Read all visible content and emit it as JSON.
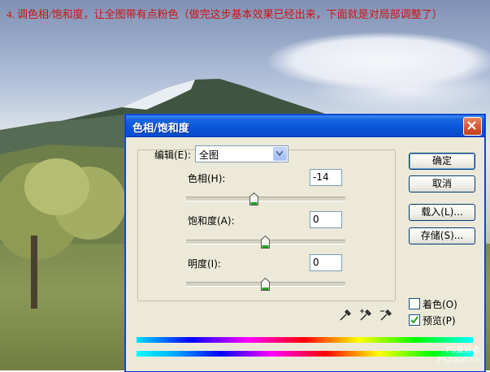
{
  "caption": "4. 调色相/饱和度，让全图带有点粉色（做完这步基本效果已经出来，下面就是对局部调整了）",
  "watermark": {
    "brand": "PS爱好者",
    "site": "PS2000.cn"
  },
  "dialog": {
    "title": "色相/饱和度",
    "edit_label": "编辑(E):",
    "edit_value": "全图",
    "hue": {
      "label": "色相(H):",
      "value": "-14",
      "fraction": 0.45
    },
    "saturation": {
      "label": "饱和度(A):",
      "value": "0",
      "fraction": 0.5
    },
    "lightness": {
      "label": "明度(I):",
      "value": "0",
      "fraction": 0.5
    },
    "buttons": {
      "ok": "确定",
      "cancel": "取消",
      "load": "载入(L)...",
      "save": "存储(S)..."
    },
    "colorize": {
      "label": "着色(O)",
      "checked": false
    },
    "preview": {
      "label": "预览(P)",
      "checked": true
    },
    "eyedroppers": [
      "eyedropper-icon",
      "eyedropper-plus-icon",
      "eyedropper-minus-icon"
    ]
  }
}
